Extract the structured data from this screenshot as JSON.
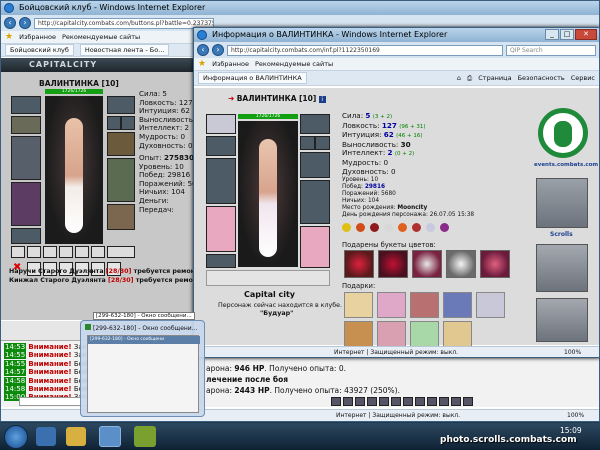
{
  "back_window": {
    "title": "Бойцовский клуб - Windows Internet Explorer",
    "address": "http://capitalcity.combats.com/buttons.pl?battle=0.237375134039702",
    "favorites_label": "Избранное",
    "recommended_label": "Рекомендуемые сайты",
    "tabs": [
      "Бойцовский клуб",
      "Новостная лента - Бо..."
    ],
    "city_banner": "CAPITALCITY",
    "char_name": "ВАЛИНТИНКА [10]",
    "hp_bar": "1726/1726",
    "stats": [
      {
        "label": "Сила:",
        "value": "5"
      },
      {
        "label": "Ловкость:",
        "value": "127"
      },
      {
        "label": "Интуиция:",
        "value": "62"
      },
      {
        "label": "Выносливость:",
        "value": "30"
      },
      {
        "label": "Интеллект:",
        "value": "2"
      },
      {
        "label": "Мудрость:",
        "value": "0"
      },
      {
        "label": "Духовность:",
        "value": "0"
      }
    ],
    "experience": [
      {
        "label": "Опыт:",
        "value": "2758309"
      },
      {
        "label": "Уровень:",
        "value": "10"
      },
      {
        "label": "Побед:",
        "value": "29816"
      },
      {
        "label": "Поражений:",
        "value": "568"
      },
      {
        "label": "Ничьих:",
        "value": "104"
      },
      {
        "label": "Деньги:",
        "value": ""
      },
      {
        "label": "Передач:",
        "value": ""
      }
    ],
    "repair_lines": [
      {
        "item": "Наручи Старого Дуэлянта",
        "counter": "[28/30]",
        "text": "требуется ремонт"
      },
      {
        "item": "Кинжал Старого Дуэлянта",
        "counter": "[28/30]",
        "text": "требуется ремонт"
      }
    ],
    "chat": [
      {
        "time": "14:53",
        "warn": "Внимание!",
        "text": "Зак"
      },
      {
        "time": "14:55",
        "warn": "Внимание!",
        "text": "Зак"
      },
      {
        "time": "14:55",
        "warn": "Внимание!",
        "text": "Бой"
      },
      {
        "time": "14:57",
        "warn": "Внимание!",
        "text": "Бой"
      },
      {
        "time": "14:58",
        "warn": "Внимание!",
        "text": "Бой"
      },
      {
        "time": "14:58",
        "warn": "Внимание!",
        "text": "Бой"
      },
      {
        "time": "15:00",
        "warn": "Внимание!",
        "text": "Зак"
      }
    ],
    "battle_lines": [
      {
        "prefix": "арона: ",
        "hp": "946 HP",
        "suffix": ". Получено опыта: 0."
      },
      {
        "prefix": "",
        "hp": "",
        "suffix": "лечение после боя"
      },
      {
        "prefix": "арона: ",
        "hp": "2443 HP",
        "suffix": ". Получено опыта: 43927 (250%)."
      }
    ],
    "status_left": "Интернет | Защищенный режим: выкл.",
    "zoom": "100%"
  },
  "front_window": {
    "title": "Информация о ВАЛИНТИНКА - Windows Internet Explorer",
    "address": "http://capitalcity.combats.com/inf.pl?1122350169",
    "search_placeholder": "QIP Search",
    "favorites_label": "Избранное",
    "recommended_label": "Рекомендуемые сайты",
    "tab_label": "Информация о ВАЛИНТИНКА",
    "commands": [
      "Страница",
      "Безопасность",
      "Сервис"
    ],
    "char_name": "ВАЛИНТИНКА",
    "level": "[10]",
    "hp_bar": "1726/1726",
    "stats": [
      {
        "label": "Сила:",
        "value": "5",
        "bonus": "(3 + 2)"
      },
      {
        "label": "Ловкость:",
        "value": "127",
        "bonus": "(96 + 31)"
      },
      {
        "label": "Интуиция:",
        "value": "62",
        "bonus": "(46 + 16)"
      },
      {
        "label": "Выносливость:",
        "value": "30",
        "bonus": ""
      },
      {
        "label": "Интеллект:",
        "value": "2",
        "bonus": "(0 + 2)"
      },
      {
        "label": "Мудрость:",
        "value": "0",
        "bonus": ""
      },
      {
        "label": "Духовность:",
        "value": "0",
        "bonus": ""
      }
    ],
    "info": [
      {
        "label": "Уровень:",
        "value": "10"
      },
      {
        "label": "Побед:",
        "value": "29816"
      },
      {
        "label": "Поражений:",
        "value": "5680"
      },
      {
        "label": "Ничьих:",
        "value": "104"
      },
      {
        "label": "Место рождения:",
        "value": "Mooncity"
      },
      {
        "label": "День рождения персонажа:",
        "value": "26.07.05 15:38"
      }
    ],
    "city_name": "Capital city",
    "location_text": "Персонаж сейчас находится в клубе.",
    "location_room": "\"Будуар\"",
    "bouquets_title": "Подарены букеты цветов:",
    "gifts_title": "Подарки:",
    "events_link": "events.combats.com",
    "scrolls_label": "Scrolls",
    "status_left": "Интернет | Защищенный режим: выкл.",
    "zoom": "100%"
  },
  "popup": {
    "title": "[299-632-180] - Окно сообщени...",
    "thumb_title": "[299-632-180] - Окно сообщени"
  },
  "taskbar": {
    "clock": "15:09",
    "watermark": "photo.scrolls.combats.com"
  },
  "colors": {
    "warn_red": "#cc0000",
    "chat_time_green": "#0b8a0b",
    "logo_green": "#1e8a3a",
    "hp_green": "#12a012"
  }
}
